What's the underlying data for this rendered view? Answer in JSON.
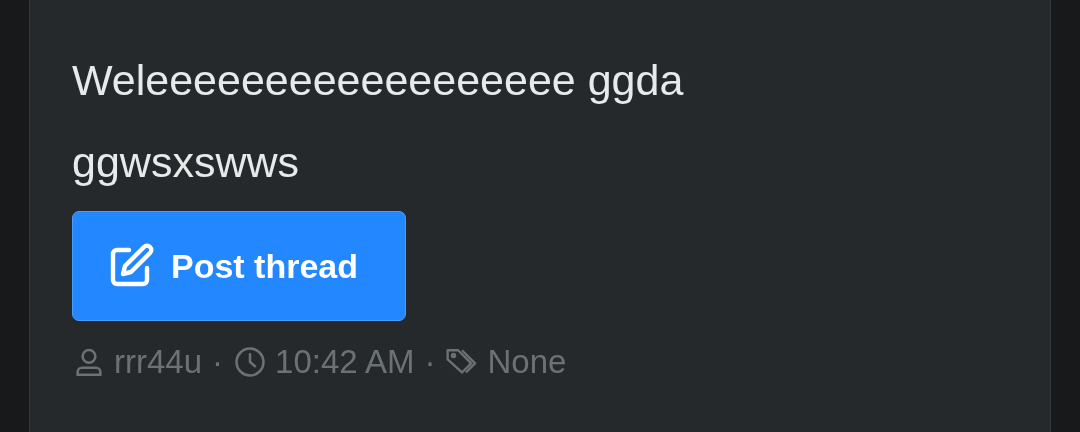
{
  "post": {
    "title": "Weleeeeeeeeeeeeeeeeee ggda ggwsxswws",
    "button": {
      "label": "Post thread"
    },
    "meta": [
      {
        "kind": "user",
        "text": "rrr44u"
      },
      {
        "kind": "separator",
        "text": "·"
      },
      {
        "kind": "time",
        "text": "10:42 AM"
      },
      {
        "kind": "separator",
        "text": "·"
      },
      {
        "kind": "tag",
        "text": "None"
      }
    ]
  }
}
